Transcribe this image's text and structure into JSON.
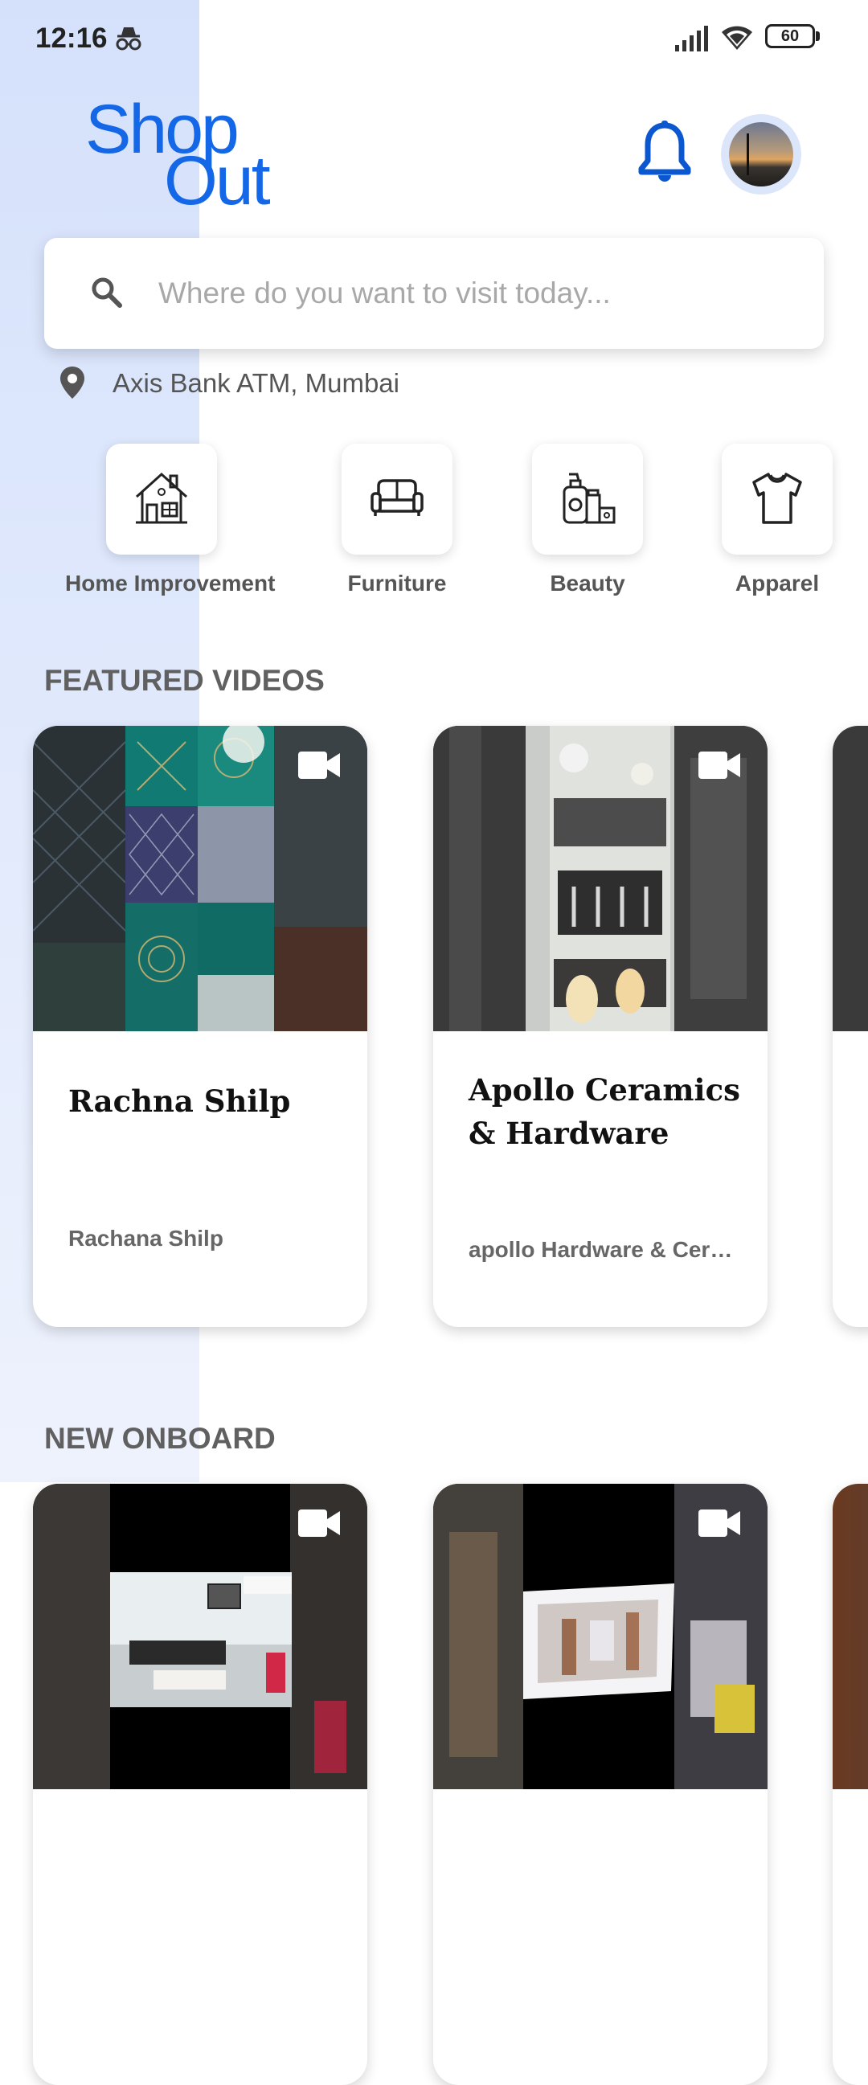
{
  "status_bar": {
    "time": "12:16",
    "battery": "60"
  },
  "logo": {
    "line1": "Shop",
    "line2": "Out"
  },
  "search": {
    "placeholder": "Where do you want to visit today..."
  },
  "location": {
    "label": "Axis Bank ATM, Mumbai"
  },
  "categories": [
    {
      "label": "Home Improvement",
      "icon": "house-icon"
    },
    {
      "label": "Furniture",
      "icon": "sofa-icon"
    },
    {
      "label": "Beauty",
      "icon": "cosmetics-icon"
    },
    {
      "label": "Apparel",
      "icon": "tshirt-icon"
    }
  ],
  "featured": {
    "title": "FEATURED VIDEOS",
    "cards": [
      {
        "title": "Rachna Shilp",
        "subtitle": "Rachana Shilp"
      },
      {
        "title": "Apollo Ceramics & Hardware",
        "subtitle": "apollo Hardware & Cera..."
      }
    ]
  },
  "onboard": {
    "title": "NEW ONBOARD"
  },
  "colors": {
    "brand": "#1468e8",
    "icon_blue": "#0b57d0",
    "band": "#d5e1fb"
  }
}
